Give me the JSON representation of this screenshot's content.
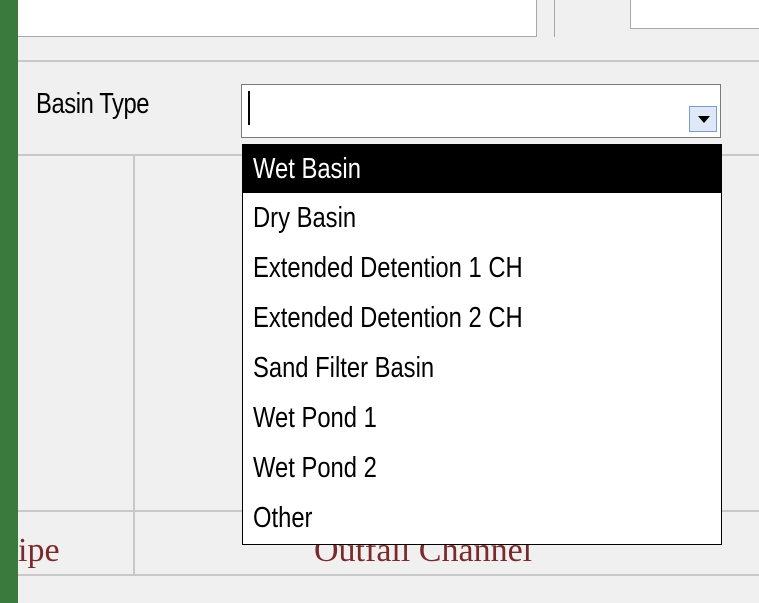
{
  "form": {
    "basin_type_label": "Basin Type",
    "basin_type_value": "",
    "dropdown_icon": "chevron-down-icon",
    "options": [
      {
        "label": "Wet Basin",
        "selected": true
      },
      {
        "label": "Dry Basin",
        "selected": false
      },
      {
        "label": "Extended Detention 1 CH",
        "selected": false
      },
      {
        "label": "Extended Detention 2 CH",
        "selected": false
      },
      {
        "label": "Sand Filter Basin",
        "selected": false
      },
      {
        "label": "Wet Pond 1",
        "selected": false
      },
      {
        "label": "Wet Pond 2",
        "selected": false
      },
      {
        "label": "Other",
        "selected": false
      }
    ],
    "footer_left": "ipe",
    "footer_center": "Outfall Channel"
  },
  "colors": {
    "window_frame": "#3a7a3c",
    "form_background": "#f0f0f0",
    "selected_option_bg": "#000000",
    "footer_text": "#7a2a2a"
  }
}
